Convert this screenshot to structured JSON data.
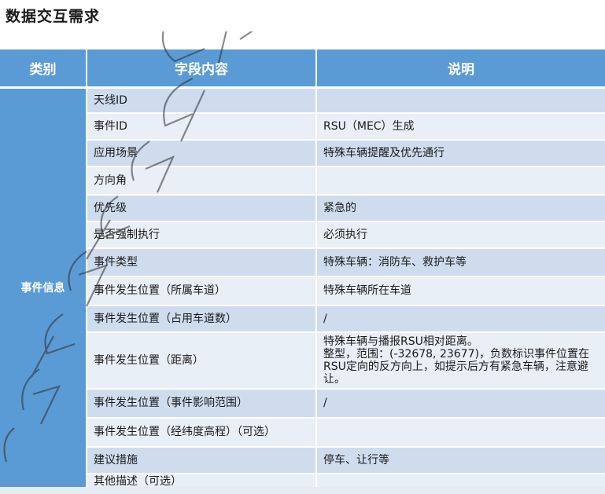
{
  "page": {
    "title": "数据交互需求"
  },
  "table": {
    "headers": [
      "类别",
      "字段内容",
      "说明"
    ],
    "category": "事件信息",
    "rows": [
      {
        "field": "天线ID",
        "desc": ""
      },
      {
        "field": "事件ID",
        "desc": "RSU（MEC）生成"
      },
      {
        "field": "应用场景",
        "desc": "特殊车辆提醒及优先通行"
      },
      {
        "field": "方向角",
        "desc": ""
      },
      {
        "field": "优先级",
        "desc": "紧急的"
      },
      {
        "field": "是否强制执行",
        "desc": "必须执行"
      },
      {
        "field": "事件类型",
        "desc": "特殊车辆：消防车、救护车等"
      },
      {
        "field": "事件发生位置（所属车道）",
        "desc": "特殊车辆所在车道"
      },
      {
        "field": "事件发生位置（占用车道数）",
        "desc": "/"
      },
      {
        "field": "事件发生位置（距离）",
        "desc": "特殊车辆与播报RSU相对距离。\n整型，范围：(-32678, 23677)，负数标识事件位置在RSU定向的反方向上，如提示后方有紧急车辆，注意避让。"
      },
      {
        "field": "事件发生位置（事件影响范围）",
        "desc": "/"
      },
      {
        "field": "事件发生位置（经纬度高程）（可选）",
        "desc": ""
      },
      {
        "field": "建议措施",
        "desc": "停车、让行等"
      },
      {
        "field": "其他描述（可选）",
        "desc": ""
      }
    ]
  },
  "colors": {
    "header_bg": "#5b9bd5",
    "row_dark": "#cfdcee",
    "row_light": "#e9eff7"
  }
}
